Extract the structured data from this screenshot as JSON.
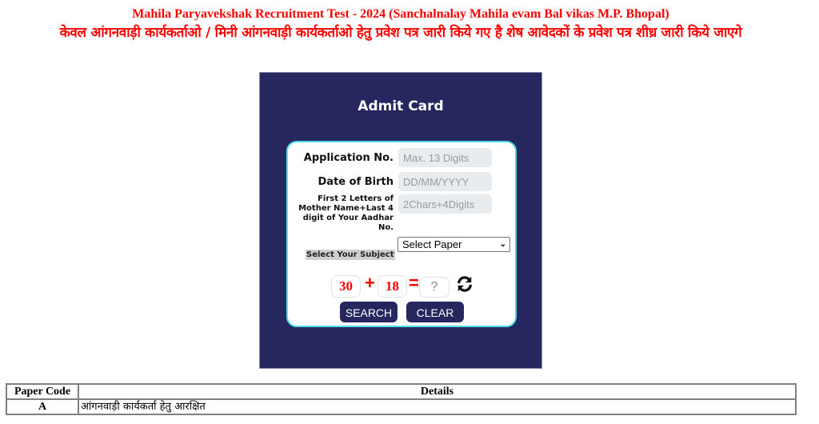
{
  "header": {
    "title_en": "Mahila Paryavekshak Recruitment Test - 2024 (Sanchalnalay Mahila evam Bal vikas M.P. Bhopal)",
    "title_hi": "केवल आंगनवाड़ी कार्यकर्ताओ / मिनी आंगनवाड़ी कार्यकर्ताओ हेतु प्रवेश पत्र जारी किये गए है शेष आवेदकों के प्रवेश पत्र शीध्र जारी किये जाएगे",
    "title_color": "#ff0000"
  },
  "admit_card": {
    "title": "Admit Card",
    "panel_color": "#27275f",
    "border_color": "#4fdde8",
    "fields": {
      "application_no": {
        "label": "Application No.",
        "placeholder": "Max. 13 Digits",
        "value": ""
      },
      "dob": {
        "label": "Date of Birth",
        "placeholder": "DD/MM/YYYY",
        "value": ""
      },
      "mother_aadhar": {
        "label": "First 2 Letters of Mother Name+Last 4 digit of Your Aadhar No.",
        "placeholder": "2Chars+4Digits",
        "value": ""
      },
      "subject": {
        "label": "Select Your Subject",
        "selected": "Select Paper"
      }
    },
    "captcha": {
      "num1": "30",
      "operator": "+",
      "num2": "18",
      "equals": "=",
      "answer_placeholder": "?",
      "refresh_icon": "refresh-icon"
    },
    "buttons": {
      "search": "SEARCH",
      "clear": "CLEAR"
    }
  },
  "paper_table": {
    "headers": [
      "Paper Code",
      "Details"
    ],
    "rows": [
      {
        "code": "A",
        "details": "आंगनवाड़ी कार्यकर्ता हेतु आरक्षित"
      }
    ]
  }
}
